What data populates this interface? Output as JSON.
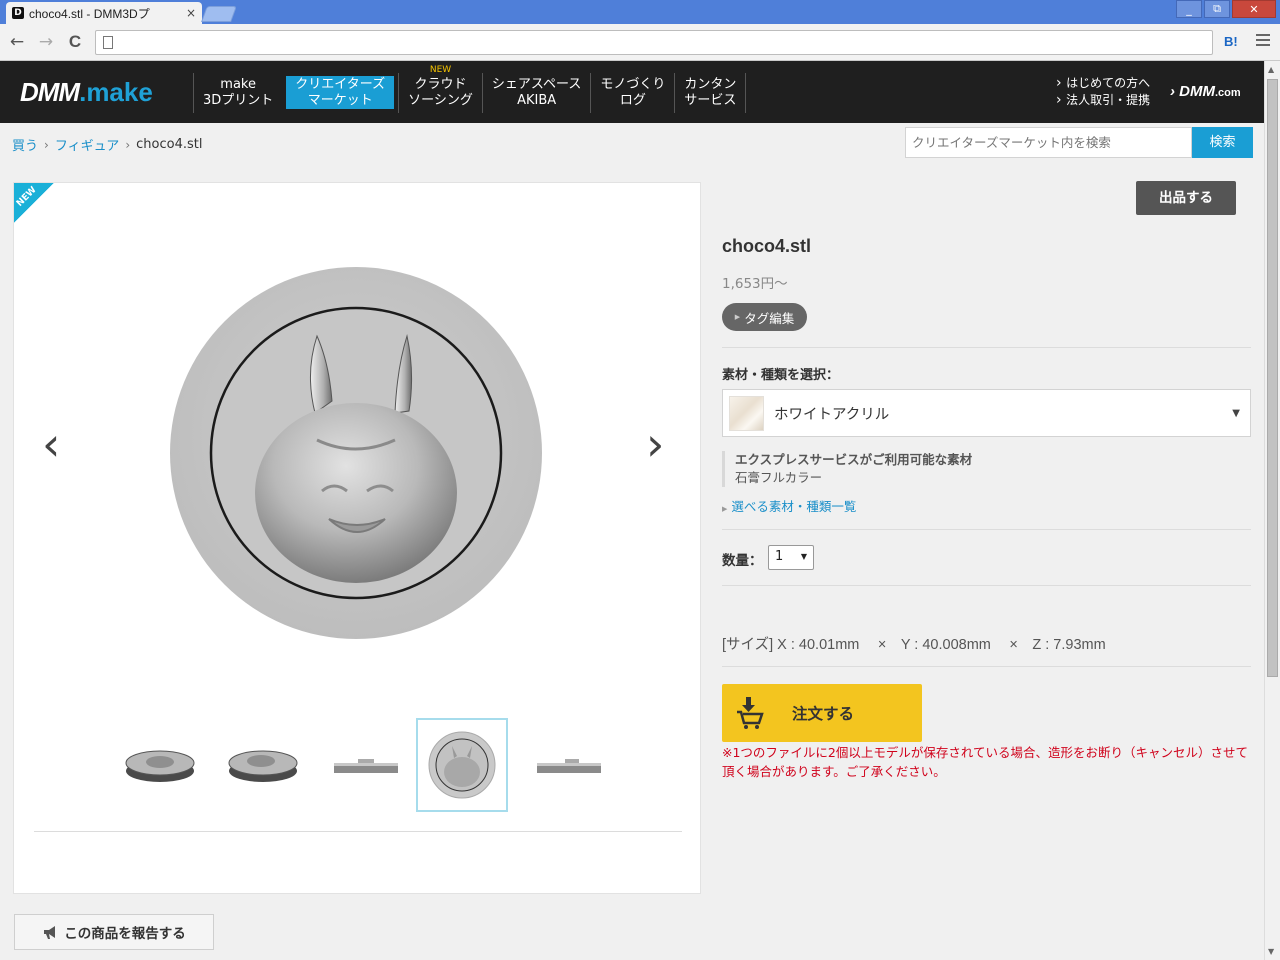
{
  "browser": {
    "tab_title": "choco4.stl - DMM3Dプ",
    "tab_favicon": "D",
    "tab_close": "×",
    "nav_back": "←",
    "nav_forward": "→",
    "nav_reload": "C",
    "address_value": "",
    "extension_label": "B!",
    "window_minimize": "_",
    "window_restore": "⧉",
    "window_close": "✕"
  },
  "header": {
    "logo_main": "DMM",
    "logo_suffix": ".make",
    "nav": [
      {
        "line1": "make",
        "line2": "3Dプリント"
      },
      {
        "line1": "クリエイターズ",
        "line2": "マーケット"
      },
      {
        "badge": "NEW",
        "line1": "クラウド",
        "line2": "ソーシング"
      },
      {
        "line1": "シェアスペース",
        "line2": "AKIBA"
      },
      {
        "line1": "モノづくり",
        "line2": "ログ"
      },
      {
        "line1": "カンタン",
        "line2": "サービス"
      }
    ],
    "links": [
      "はじめての方へ",
      "法人取引・提携"
    ],
    "dmm_com_main": "› DMM",
    "dmm_com_suffix": ".com"
  },
  "breadcrumb": {
    "items": [
      "買う",
      "フィギュア",
      "choco4.stl"
    ],
    "separator": "›"
  },
  "search": {
    "placeholder": "クリエイターズマーケット内を検索",
    "button_label": "検索"
  },
  "gallery": {
    "new_badge": "NEW",
    "prev_arrow": "‹",
    "next_arrow": "›",
    "thumbnail_count": 5,
    "selected_thumbnail": 4
  },
  "product": {
    "sell_button": "出品する",
    "title": "choco4.stl",
    "price": "1,653円〜",
    "tag_edit_button": "タグ編集",
    "material_label": "素材・種類を選択：",
    "material_selected": "ホワイトアクリル",
    "express_title": "エクスプレスサービスがご利用可能な素材",
    "express_material": "石膏フルカラー",
    "material_list_link": "選べる素材・種類一覧",
    "quantity_label": "数量：",
    "quantity_value": "1",
    "size_text": "[サイズ] X : 40.01mm　 ×　Y : 40.008mm　 ×　Z : 7.93mm",
    "order_button": "注文する",
    "order_note": "※1つのファイルに2個以上モデルが保存されている場合、造形をお断り（キャンセル）させて頂く場合があります。ご了承ください。"
  },
  "report_button": "この商品を報告する",
  "icons": {
    "favicon": "dmm-favicon-icon",
    "cart": "cart-download-icon",
    "megaphone": "megaphone-icon",
    "triangle": "play-triangle-icon"
  },
  "colors": {
    "header_bg": "#1f1f1f",
    "accent_blue": "#1a9ed4",
    "order_yellow": "#f3c51f",
    "note_red": "#d0021b",
    "link_blue": "#1a8fc9"
  }
}
